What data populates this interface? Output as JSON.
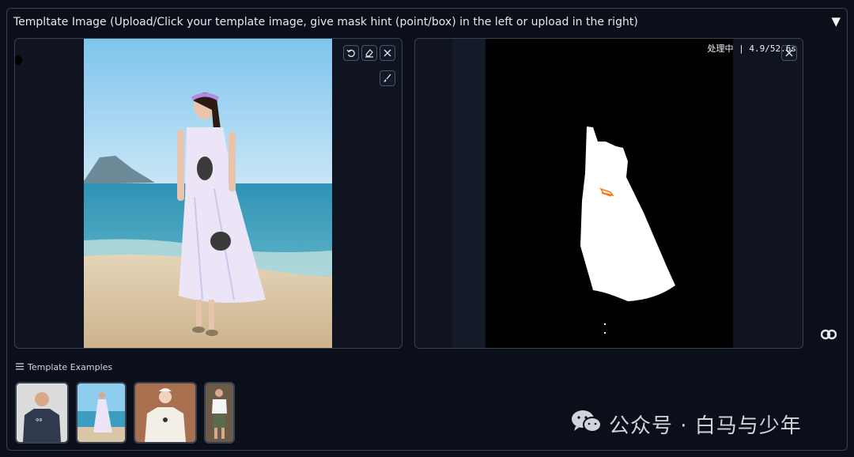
{
  "panel": {
    "title": "Templtate Image (Upload/Click your template image, give mask hint (point/box) in the left or upload in the right)",
    "toggle": "▼"
  },
  "left_image": {
    "tools": [
      "undo-icon",
      "eraser-icon",
      "close-icon",
      "brush-icon"
    ]
  },
  "right_image": {
    "processing_text": "处理中 | 4.9/52.6s",
    "tools": [
      "close-icon"
    ]
  },
  "examples": {
    "label": "Template Examples",
    "items": [
      "example-tshirt-man",
      "example-white-dress",
      "example-tshirt-woman",
      "example-man-outfit"
    ]
  },
  "watermark": {
    "text": "公众号 · 白马与少年"
  }
}
